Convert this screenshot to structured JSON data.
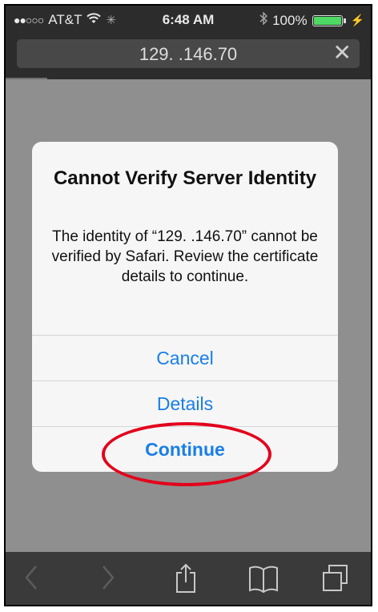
{
  "status_bar": {
    "signal": "●●○○○",
    "carrier": "AT&T",
    "time": "6:48 AM",
    "battery": "100%"
  },
  "address_bar": {
    "url": "129.   .146.70"
  },
  "alert": {
    "title": "Cannot Verify Server Identity",
    "message": "The identity of “129.      .146.70” cannot be verified by Safari. Review the certificate details to continue.",
    "buttons": {
      "cancel": "Cancel",
      "details": "Details",
      "continue": "Continue"
    }
  },
  "colors": {
    "accent": "#1a7ee6",
    "highlight": "#e3001b"
  }
}
